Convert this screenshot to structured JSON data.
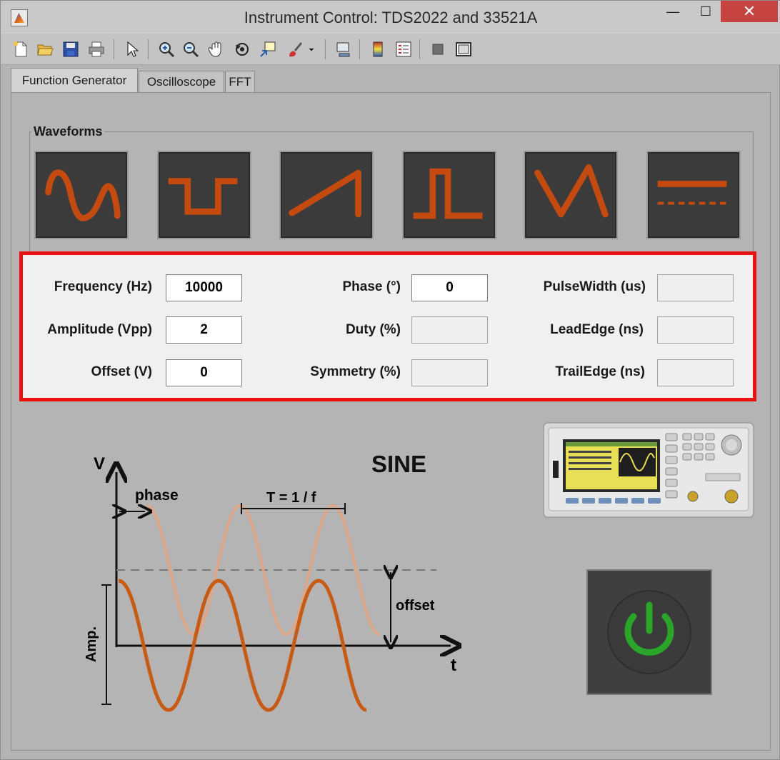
{
  "window": {
    "title": "Instrument Control: TDS2022 and 33521A",
    "controls": {
      "minimize": "—",
      "maximize": "☐",
      "close": "✕"
    }
  },
  "toolbar": {
    "items": [
      "new-file-icon",
      "open-folder-icon",
      "save-icon",
      "print-icon",
      "pointer-icon",
      "zoom-in-icon",
      "zoom-out-icon",
      "pan-hand-icon",
      "rotate-3d-icon",
      "data-cursor-icon",
      "brush-icon",
      "link-plot-icon",
      "colorbar-icon",
      "legend-icon",
      "hide-plot-tools-icon",
      "show-plot-tools-icon"
    ]
  },
  "tabs": [
    {
      "label": "Function Generator",
      "active": true
    },
    {
      "label": "Oscilloscope",
      "active": false
    },
    {
      "label": "FFT",
      "active": false
    }
  ],
  "waveforms": {
    "group_label": "Waveforms",
    "buttons": [
      "sine",
      "square",
      "ramp",
      "pulse",
      "triangle",
      "dc"
    ],
    "accent": "#c44a10"
  },
  "params": {
    "frequency": {
      "label": "Frequency (Hz)",
      "value": "10000"
    },
    "amplitude": {
      "label": "Amplitude (Vpp)",
      "value": "2"
    },
    "offset": {
      "label": "Offset (V)",
      "value": "0"
    },
    "phase": {
      "label": "Phase (°)",
      "value": "0"
    },
    "duty": {
      "label": "Duty (%)",
      "value": ""
    },
    "symmetry": {
      "label": "Symmetry (%)",
      "value": ""
    },
    "pulsewidth": {
      "label": "PulseWidth (us)",
      "value": ""
    },
    "leadedge": {
      "label": "LeadEdge (ns)",
      "value": ""
    },
    "trailedge": {
      "label": "TrailEdge (ns)",
      "value": ""
    }
  },
  "diagram": {
    "title": "SINE",
    "y_axis": "V",
    "x_axis": "t",
    "phase_label": "phase",
    "period_label": "T = 1 / f",
    "offset_label": "offset",
    "amp_label": "Amp."
  },
  "power": {
    "color": "#2aa52a"
  }
}
